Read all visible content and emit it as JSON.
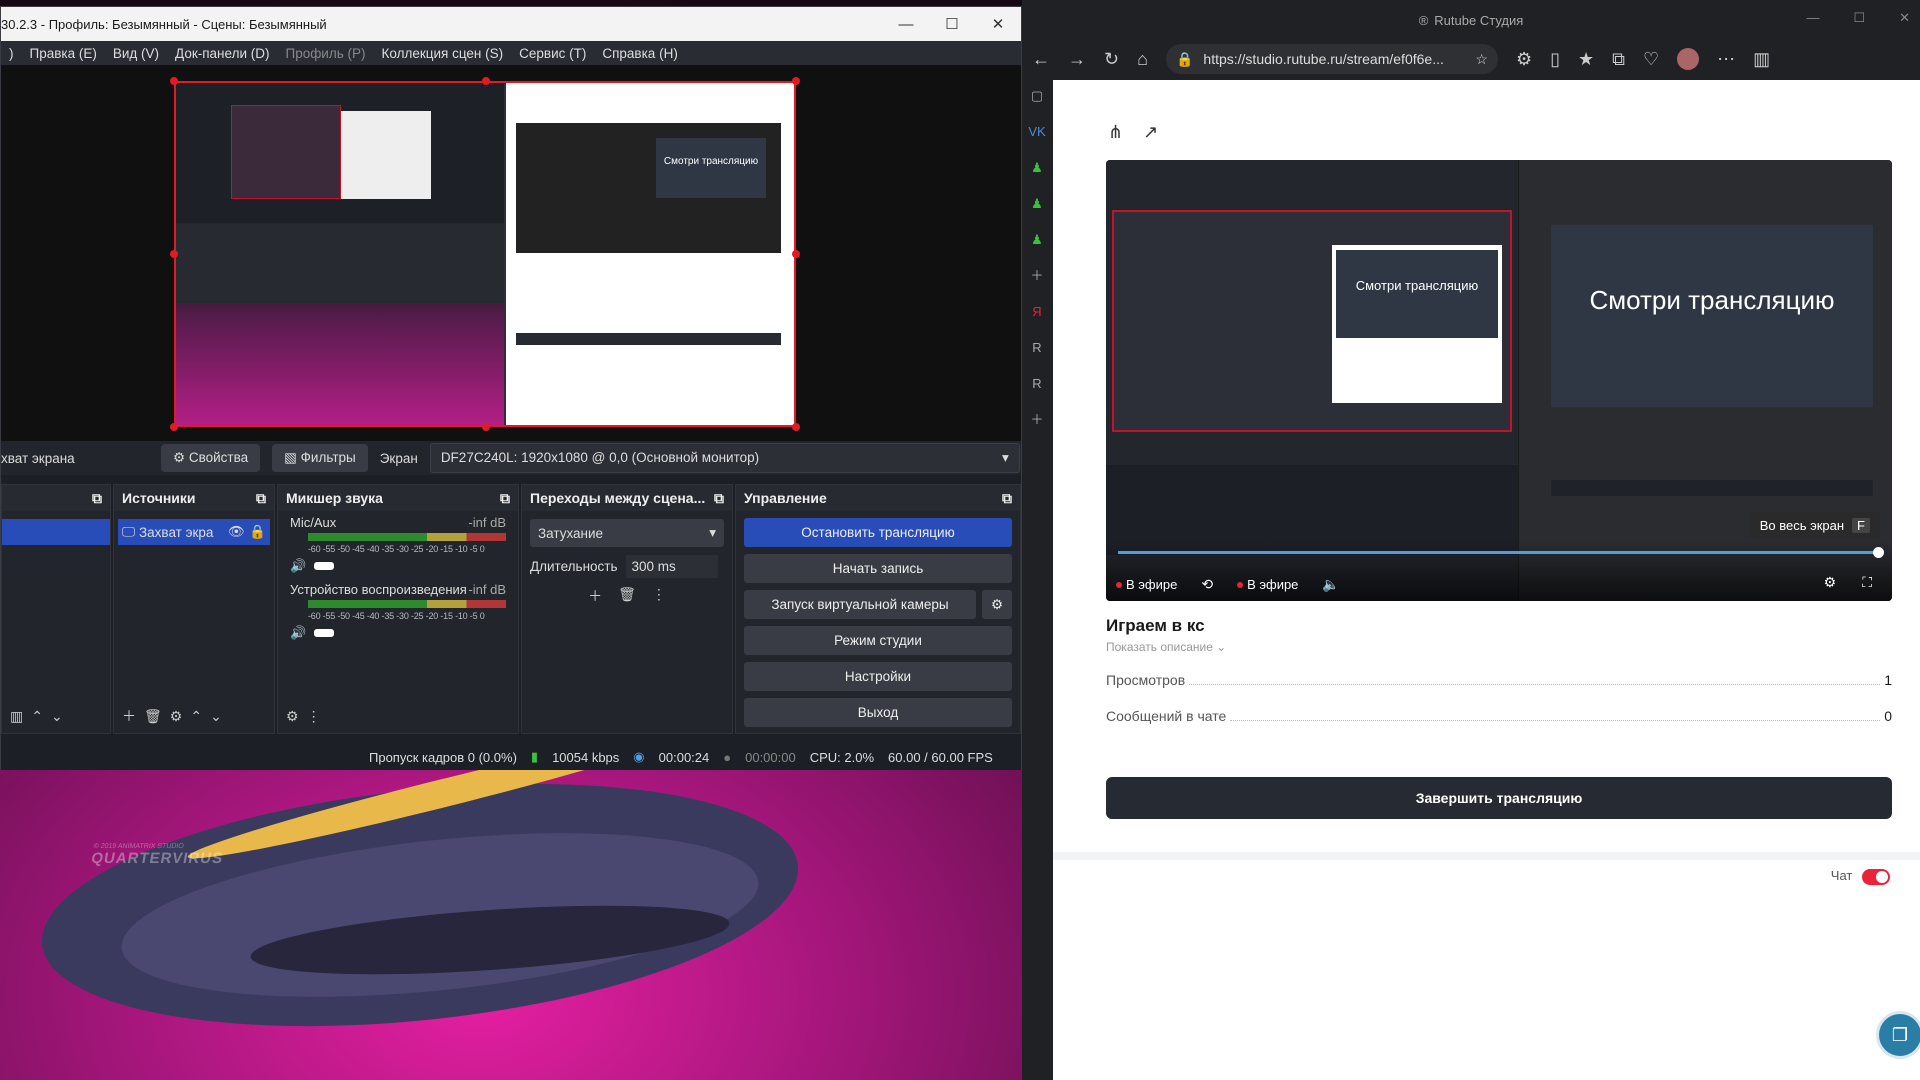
{
  "obs": {
    "title": "30.2.3 - Профиль: Безымянный - Сцены: Безымянный",
    "menu": [
      "Правка (E)",
      "Вид (V)",
      "Док-панели (D)",
      "Профиль (P)",
      "Коллекция сцен (S)",
      "Сервис (T)",
      "Справка (H)"
    ],
    "source_bar": {
      "source_name": "хват экрана",
      "properties": "Свойства",
      "filters": "Фильтры",
      "screen_label": "Экран",
      "screen_value": "DF27C240L: 1920x1080 @ 0,0 (Основной монитор)"
    },
    "sources": {
      "title": "Источники",
      "item": "Захват экра"
    },
    "mixer": {
      "title": "Микшер звука",
      "ch1_name": "Mic/Aux",
      "ch1_level": "-inf dB",
      "ch2_name": "Устройство воспроизведения",
      "ch2_level": "-inf dB",
      "scale": "-60 -55 -50 -45 -40 -35 -30 -25 -20 -15 -10 -5 0"
    },
    "transitions": {
      "title": "Переходы между сцена...",
      "type": "Затухание",
      "duration_label": "Длительность",
      "duration_value": "300 ms"
    },
    "controls": {
      "title": "Управление",
      "stop_stream": "Остановить трансляцию",
      "start_record": "Начать запись",
      "virtual_cam": "Запуск виртуальной камеры",
      "studio_mode": "Режим студии",
      "settings": "Настройки",
      "exit": "Выход"
    },
    "status": {
      "dropped": "Пропуск кадров 0 (0.0%)",
      "bitrate": "10054 kbps",
      "stream_time": "00:00:24",
      "rec_time": "00:00:00",
      "cpu": "CPU: 2.0%",
      "fps": "60.00 / 60.00 FPS"
    },
    "preview_card_text": "Смотри трансляцию"
  },
  "browser": {
    "title": "Rutube Студия",
    "url": "https://studio.rutube.ru/stream/ef0f6e...",
    "video": {
      "card_text": "Смотри трансляцию",
      "tooltip": "Во весь экран",
      "tooltip_key": "F",
      "live_label": "В эфире",
      "progress": 1.0
    },
    "stream_title": "Играем в кс",
    "show_description": "Показать описание",
    "views_label": "Просмотров",
    "views_value": "1",
    "chat_msgs_label": "Сообщений в чате",
    "chat_msgs_value": "0",
    "end_button": "Завершить трансляцию",
    "chat_label": "Чат",
    "chat_enabled": true
  },
  "desktop": {
    "watermark": "QUARTERVIRUS",
    "watermark_small": "© 2019 ANIMATRIX STUDIO"
  },
  "colors": {
    "accent_blue": "#284cb8",
    "live_red": "#e8233a",
    "selection_red": "#e01b24"
  }
}
